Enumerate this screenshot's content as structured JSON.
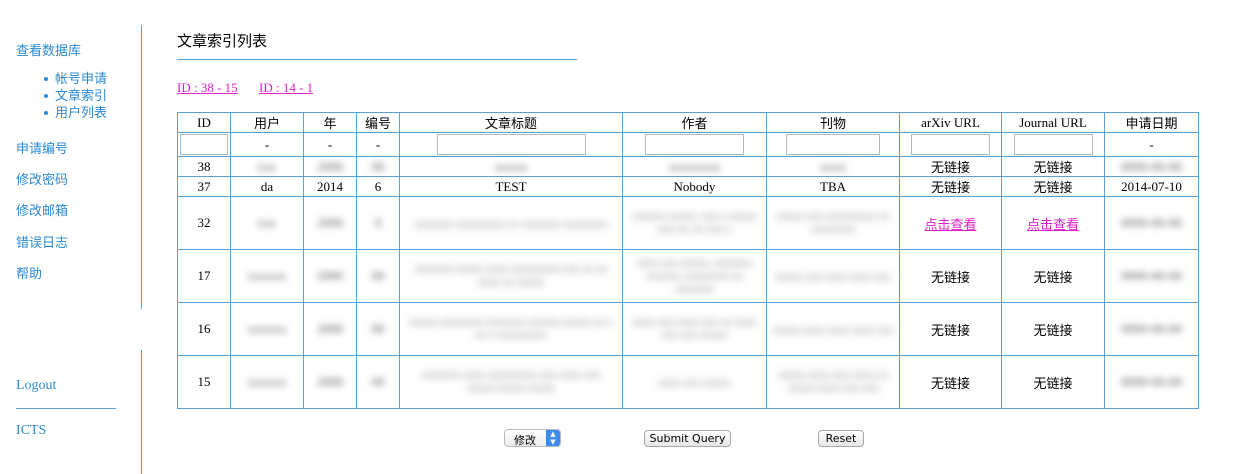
{
  "sidebar": {
    "items": [
      {
        "label": "查看数据库"
      },
      {
        "label": "申请编号"
      },
      {
        "label": "修改密码"
      },
      {
        "label": "修改邮箱"
      },
      {
        "label": "错误日志"
      },
      {
        "label": "帮助"
      }
    ],
    "sub_items": [
      {
        "label": "帐号申请"
      },
      {
        "label": "文章索引"
      },
      {
        "label": "用户列表"
      }
    ],
    "logout": "Logout",
    "icts": "ICTS"
  },
  "main": {
    "title": "文章索引列表",
    "ranges": [
      "ID : 38 - 15",
      "ID : 14 - 1"
    ],
    "table": {
      "headers": [
        "ID",
        "用户",
        "年",
        "编号",
        "文章标题",
        "作者",
        "刊物",
        "arXiv URL",
        "Journal URL",
        "申请日期"
      ],
      "filter_placeholders": {
        "user": "-",
        "year": "-",
        "number": "-",
        "date": "-"
      },
      "rows": [
        {
          "id": "38",
          "user": "",
          "year": "",
          "number": "",
          "title": "",
          "authors": "",
          "journal": "",
          "arxiv": "无链接",
          "journal_url": "无链接",
          "date": ""
        },
        {
          "id": "37",
          "user": "da",
          "year": "2014",
          "number": "6",
          "title": "TEST",
          "authors": "Nobody",
          "journal": "TBA",
          "arxiv": "无链接",
          "journal_url": "无链接",
          "date": "2014-07-10"
        },
        {
          "id": "32",
          "user": "",
          "year": "",
          "number": "",
          "title": "",
          "authors": "",
          "journal": "",
          "arxiv": "点击查看",
          "journal_url": "点击查看",
          "date": ""
        },
        {
          "id": "17",
          "user": "",
          "year": "",
          "number": "",
          "title": "",
          "authors": "",
          "journal": "",
          "arxiv": "无链接",
          "journal_url": "无链接",
          "date": ""
        },
        {
          "id": "16",
          "user": "",
          "year": "",
          "number": "",
          "title": "",
          "authors": "",
          "journal": "",
          "arxiv": "无链接",
          "journal_url": "无链接",
          "date": ""
        },
        {
          "id": "15",
          "user": "",
          "year": "",
          "number": "",
          "title": "",
          "authors": "",
          "journal": "",
          "arxiv": "无链接",
          "journal_url": "无链接",
          "date": ""
        }
      ]
    }
  },
  "controls": {
    "action_select": "修改",
    "submit": "Submit Query",
    "reset": "Reset"
  },
  "colors": {
    "link_blue": "#2a8ad4",
    "link_magenta": "#e020c8",
    "border_blue": "#5aa0d8"
  }
}
